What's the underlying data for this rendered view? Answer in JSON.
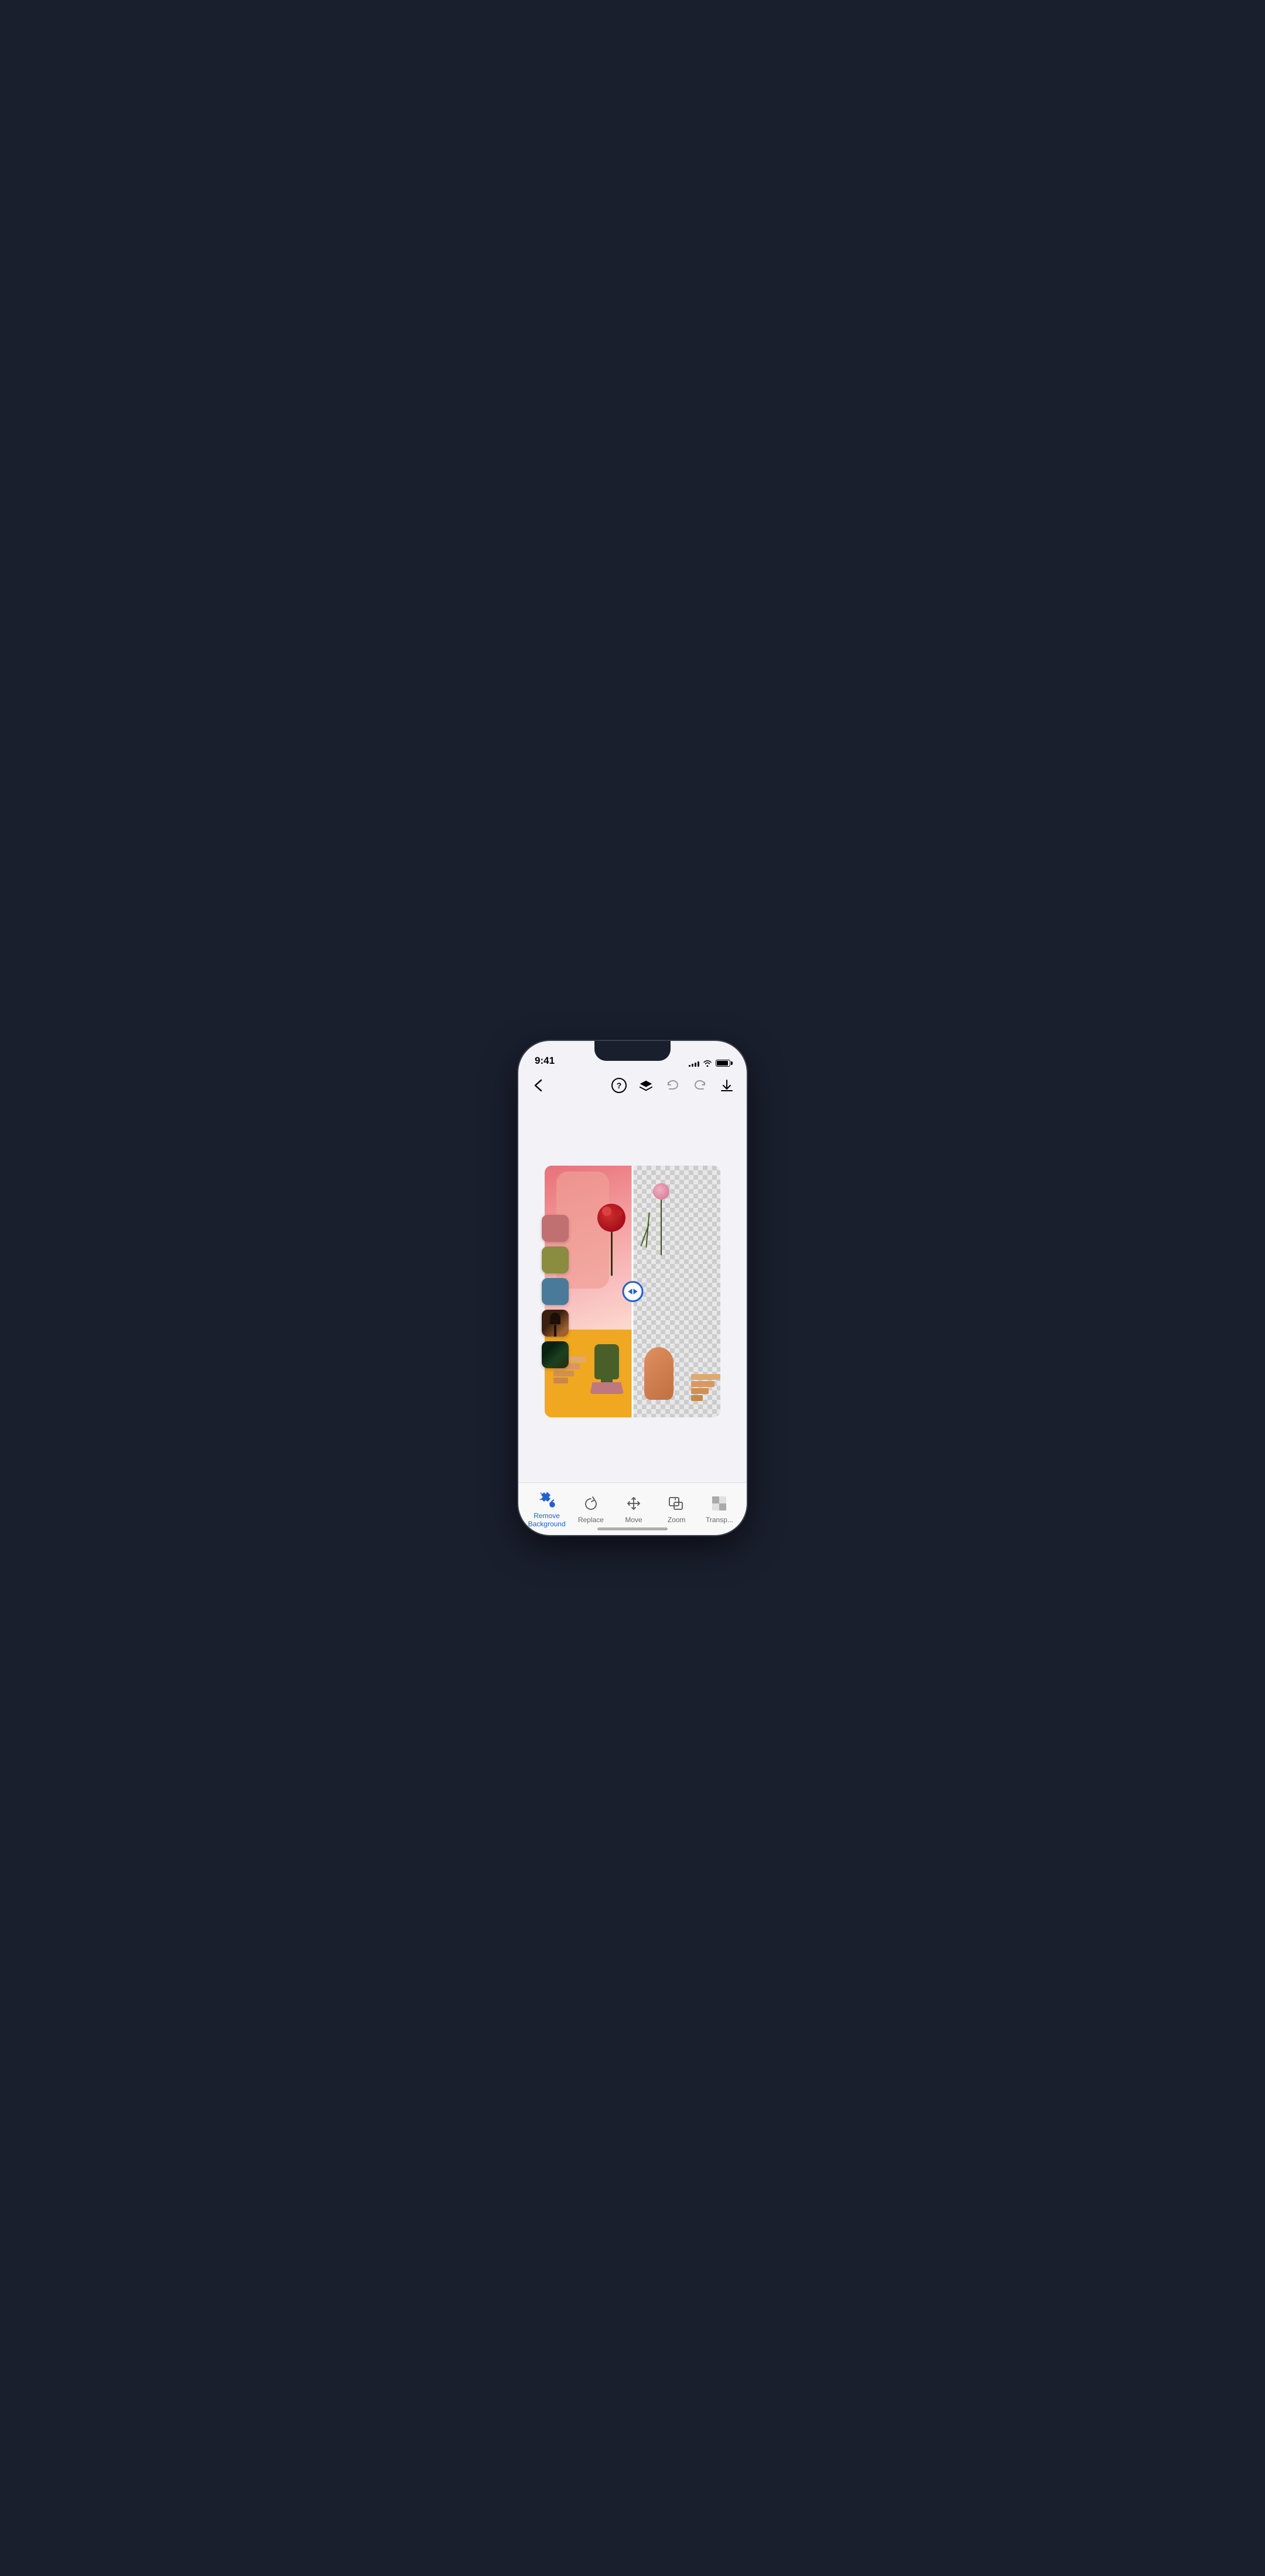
{
  "statusBar": {
    "time": "9:41",
    "signalBars": [
      3,
      5,
      7,
      9,
      11
    ],
    "wifiSymbol": "wifi",
    "batteryLevel": 90
  },
  "toolbar": {
    "backLabel": "‹",
    "helpLabel": "?",
    "layersLabel": "layers",
    "undoLabel": "undo",
    "redoLabel": "redo",
    "downloadLabel": "download"
  },
  "canvas": {
    "splitSliderAlt": "before/after comparison slider"
  },
  "colorSwatches": [
    {
      "color": "#c07070",
      "type": "solid"
    },
    {
      "color": "#8a8c40",
      "type": "solid"
    },
    {
      "color": "#4a7a9a",
      "type": "solid"
    },
    {
      "type": "image",
      "alt": "nature texture 1"
    },
    {
      "type": "image",
      "alt": "nature texture 2"
    }
  ],
  "bottomToolbar": {
    "tools": [
      {
        "id": "remove-bg",
        "label": "Remove\nBackground",
        "active": true
      },
      {
        "id": "replace",
        "label": "Replace",
        "active": false
      },
      {
        "id": "move",
        "label": "Move",
        "active": false
      },
      {
        "id": "zoom",
        "label": "Zoom",
        "active": false
      },
      {
        "id": "transp",
        "label": "Transp...",
        "active": false
      }
    ]
  }
}
